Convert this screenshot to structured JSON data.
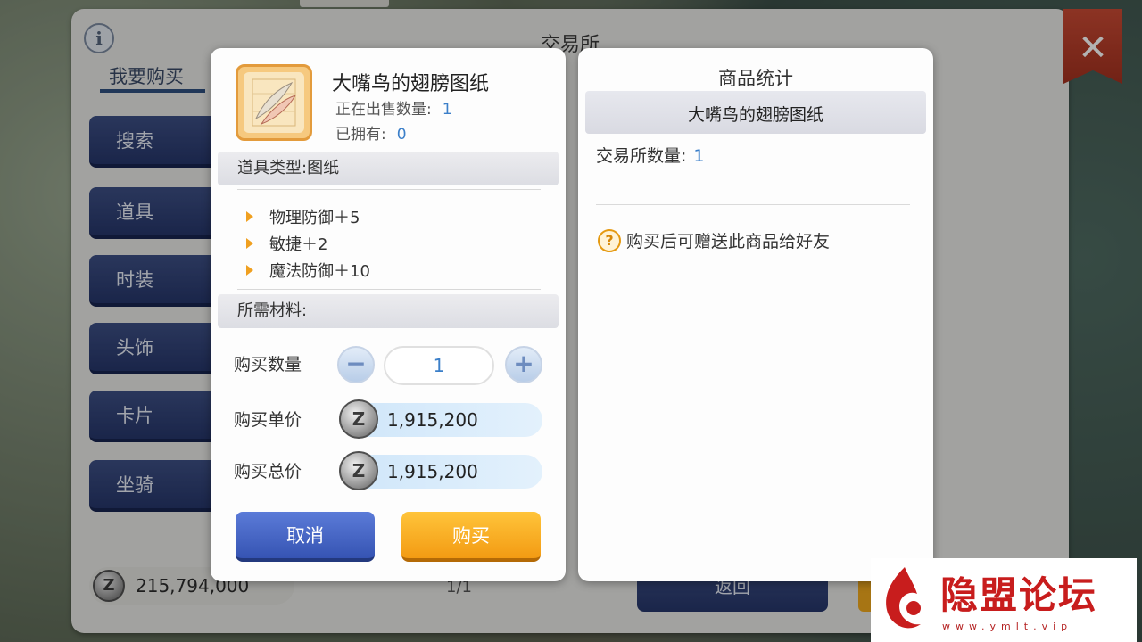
{
  "background": {
    "top_banner_label": "",
    "window_title": "交易所",
    "info_icon": "info-icon",
    "close_icon": "close-icon",
    "tab_buy": "我要购买",
    "categories": [
      "搜索",
      "道具",
      "时装",
      "头饰",
      "卡片",
      "坐骑"
    ],
    "money": "215,794,000",
    "page_indicator": "1/1",
    "back_label": "返回"
  },
  "item_panel": {
    "name": "大嘴鸟的翅膀图纸",
    "on_sale_label": "正在出售数量:",
    "on_sale_value": "1",
    "owned_label": "已拥有:",
    "owned_value": "0",
    "type_label": "道具类型:图纸",
    "attributes": [
      "物理防御＋5",
      "敏捷＋2",
      "魔法防御＋10"
    ],
    "materials_label": "所需材料:",
    "quantity_label": "购买数量",
    "quantity_value": "1",
    "unit_price_label": "购买单价",
    "unit_price": "1,915,200",
    "total_price_label": "购买总价",
    "total_price": "1,915,200",
    "cancel_label": "取消",
    "buy_label": "购买"
  },
  "stats_panel": {
    "title": "商品统计",
    "item_name": "大嘴鸟的翅膀图纸",
    "count_label": "交易所数量:",
    "count_value": "1",
    "gift_hint": "购买后可赠送此商品给好友"
  },
  "watermark": {
    "text": "隐盟论坛",
    "url": "www.ymlt.vip"
  },
  "colors": {
    "accent_blue": "#3b7fc9",
    "buy_orange": "#f39b13",
    "cancel_blue": "#3654b3",
    "watermark_red": "#c81d1d"
  }
}
